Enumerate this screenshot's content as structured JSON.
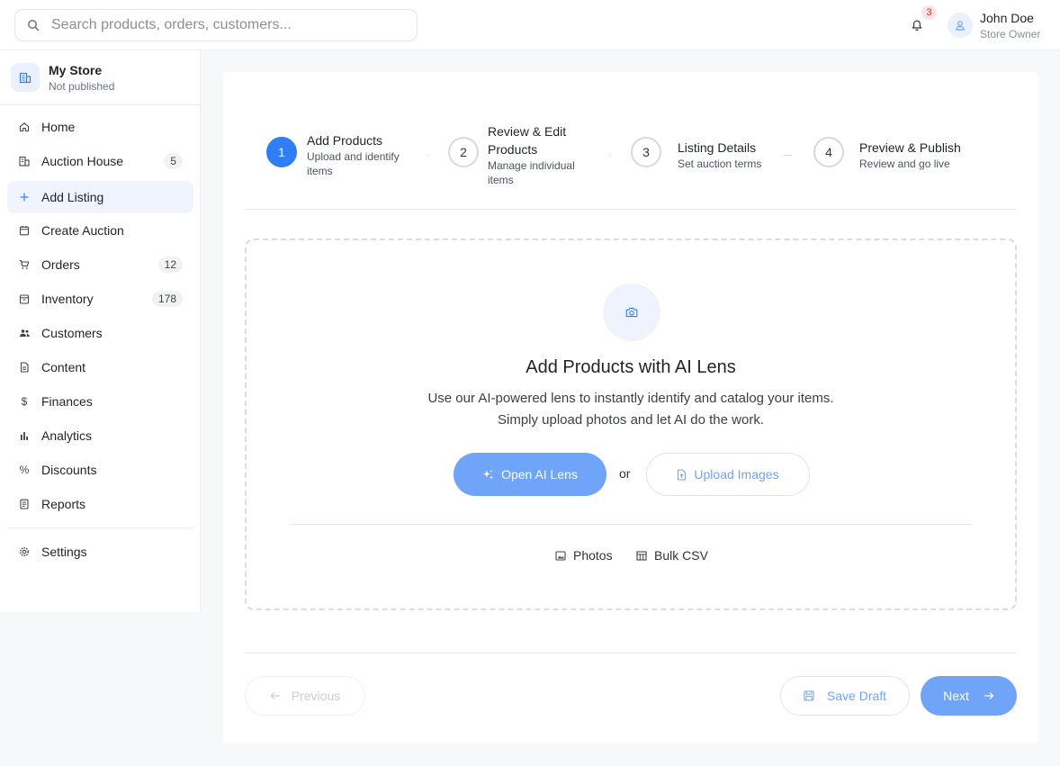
{
  "header": {
    "search_placeholder": "Search products, orders, customers...",
    "notification_count": "3",
    "user_name": "John Doe",
    "user_role": "Store Owner"
  },
  "store": {
    "name": "My Store",
    "status": "Not published"
  },
  "sidebar": {
    "items": [
      {
        "label": "Home",
        "icon": "home-icon",
        "count": ""
      },
      {
        "label": "Auction House",
        "icon": "building-icon",
        "count": "5"
      },
      {
        "label": "Add Listing",
        "icon": "plus-icon",
        "count": ""
      },
      {
        "label": "Create Auction",
        "icon": "calendar-icon",
        "count": ""
      },
      {
        "label": "Orders",
        "icon": "cart-icon",
        "count": "12"
      },
      {
        "label": "Inventory",
        "icon": "box-icon",
        "count": "178"
      },
      {
        "label": "Customers",
        "icon": "users-icon",
        "count": ""
      },
      {
        "label": "Content",
        "icon": "document-icon",
        "count": ""
      },
      {
        "label": "Finances",
        "icon": "dollar-icon",
        "count": ""
      },
      {
        "label": "Analytics",
        "icon": "bar-chart-icon",
        "count": ""
      },
      {
        "label": "Discounts",
        "icon": "percent-icon",
        "count": ""
      },
      {
        "label": "Reports",
        "icon": "report-icon",
        "count": ""
      }
    ],
    "settings_label": "Settings",
    "active_item": "Add Listing"
  },
  "stepper": {
    "steps": [
      {
        "number": "1",
        "title": "Add Products",
        "subtitle": "Upload and identify items"
      },
      {
        "number": "2",
        "title": "Review & Edit Products",
        "subtitle": "Manage individual items"
      },
      {
        "number": "3",
        "title": "Listing Details",
        "subtitle": "Set auction terms"
      },
      {
        "number": "4",
        "title": "Preview & Publish",
        "subtitle": "Review and go live"
      }
    ],
    "current_step": 1
  },
  "dropzone": {
    "title": "Add Products with AI Lens",
    "description": "Use our AI-powered lens to instantly identify and catalog your items. Simply upload photos and let AI do the work.",
    "primary_button": "Open AI Lens",
    "or_text": "or",
    "secondary_button": "Upload Images",
    "options": [
      "Photos",
      "Bulk CSV"
    ]
  },
  "footer": {
    "previous_label": "Previous",
    "save_draft_label": "Save Draft",
    "next_label": "Next"
  },
  "colors": {
    "accent": "#2f7ef7",
    "accent_light": "#6fa4f8",
    "active_nav_bg": "#eff4fe"
  }
}
